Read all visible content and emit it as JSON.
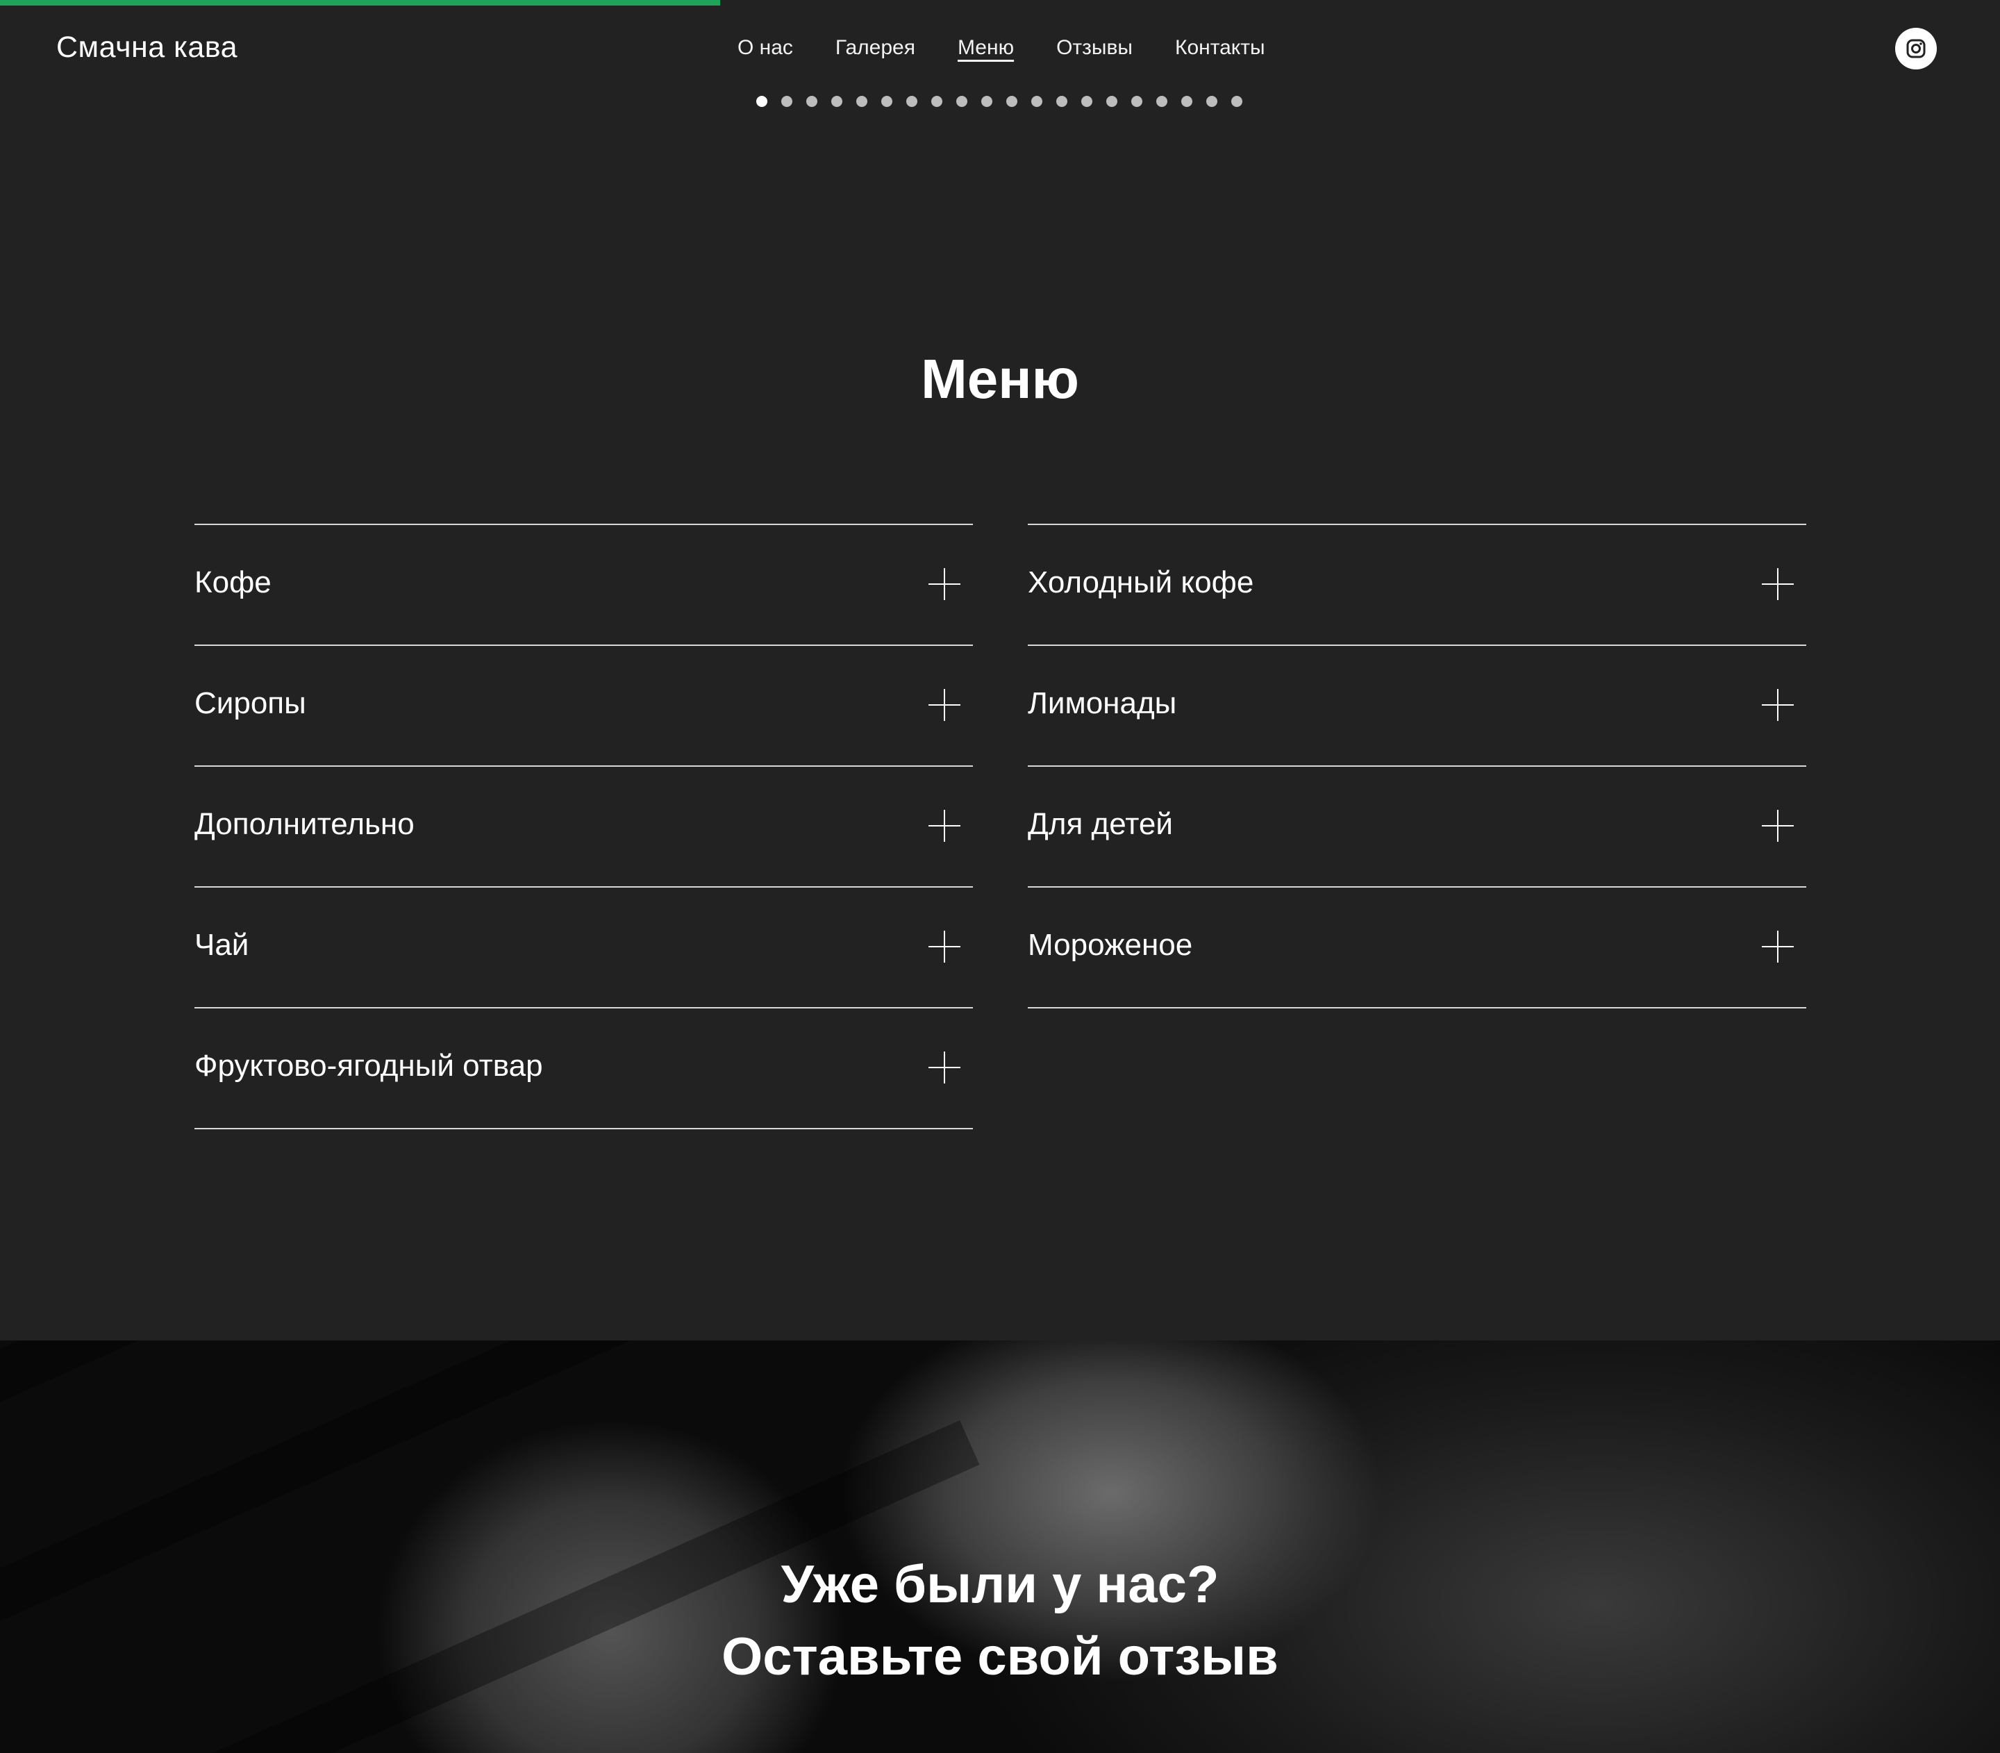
{
  "header": {
    "brand": "Смачна кава",
    "progress_color": "#1fa35a",
    "progress_percent": 36,
    "nav": [
      {
        "label": "О нас",
        "active": false
      },
      {
        "label": "Галерея",
        "active": false
      },
      {
        "label": "Меню",
        "active": true
      },
      {
        "label": "Отзывы",
        "active": false
      },
      {
        "label": "Контакты",
        "active": false
      }
    ],
    "social_icon": "instagram-icon",
    "carousel": {
      "total": 20,
      "active_index": 0
    }
  },
  "menu": {
    "title": "Меню",
    "expand_icon": "plus-icon",
    "left_items": [
      "Кофе",
      "Сиропы",
      "Дополнительно",
      "Чай",
      "Фруктово-ягодный отвар"
    ],
    "right_items": [
      "Холодный кофе",
      "Лимонады",
      "Для детей",
      "Мороженое"
    ]
  },
  "reviews": {
    "line1": "Уже были у нас?",
    "line2": "Оставьте свой отзыв"
  }
}
